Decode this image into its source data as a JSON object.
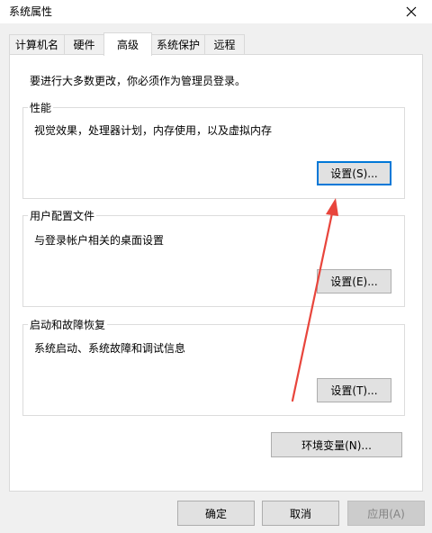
{
  "window": {
    "title": "系统属性",
    "close_icon": "close-icon"
  },
  "tabs": [
    {
      "label": "计算机名",
      "active": false
    },
    {
      "label": "硬件",
      "active": false
    },
    {
      "label": "高级",
      "active": true
    },
    {
      "label": "系统保护",
      "active": false
    },
    {
      "label": "远程",
      "active": false
    }
  ],
  "advanced": {
    "admin_notice": "要进行大多数更改，你必须作为管理员登录。",
    "performance": {
      "title": "性能",
      "description": "视觉效果，处理器计划，内存使用，以及虚拟内存",
      "settings_label": "设置(S)..."
    },
    "user_profiles": {
      "title": "用户配置文件",
      "description": "与登录帐户相关的桌面设置",
      "settings_label": "设置(E)..."
    },
    "startup_recovery": {
      "title": "启动和故障恢复",
      "description": "系统启动、系统故障和调试信息",
      "settings_label": "设置(T)..."
    },
    "env_vars_label": "环境变量(N)..."
  },
  "footer": {
    "ok_label": "确定",
    "cancel_label": "取消",
    "apply_label": "应用(A)"
  },
  "colors": {
    "focus_border": "#0078d7",
    "annotation_arrow": "#e8453c"
  }
}
